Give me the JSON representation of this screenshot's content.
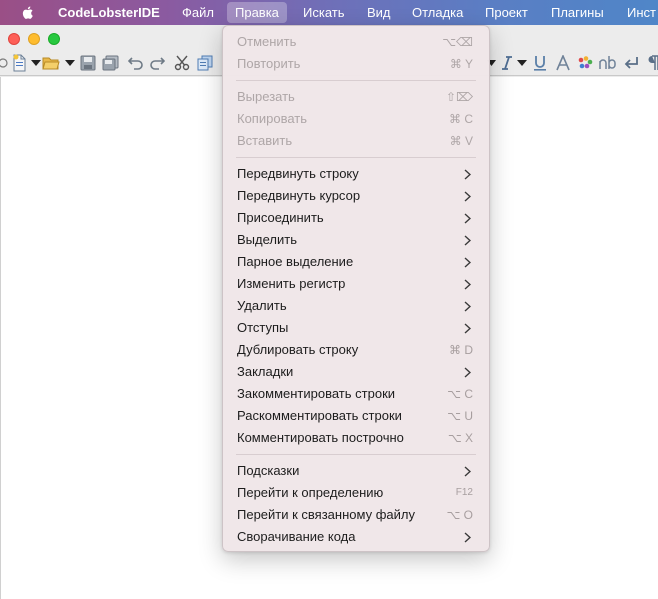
{
  "menubar": {
    "app_name": "CodeLobsterIDE",
    "items": [
      "Файл",
      "Правка",
      "Искать",
      "Вид",
      "Отладка",
      "Проект",
      "Плагины",
      "Инст"
    ],
    "active_item": "Правка"
  },
  "colors": {
    "menu_bg": "#f0e7e9",
    "disabled_text": "#aea6a7",
    "shortcut_text": "#a79e9f",
    "text": "#1d1d1d"
  },
  "icons": {
    "toolbar": [
      "new-file-icon",
      "open-folder-icon",
      "save-icon",
      "save-all-icon",
      "undo-icon",
      "redo-icon",
      "cut-icon",
      "copy-icon",
      "italic-icon",
      "underline-icon",
      "font-icon",
      "color-palette-icon",
      "nbsp-icon",
      "line-break-icon",
      "paragraph-icon"
    ]
  },
  "edit_menu": {
    "items": [
      {
        "label": "Отменить",
        "shortcut": "⌥⌫",
        "disabled": true
      },
      {
        "label": "Повторить",
        "shortcut": "⌘ Y",
        "disabled": true
      },
      {
        "label": "Вырезать",
        "shortcut": "⇧⌦",
        "disabled": true
      },
      {
        "label": "Копировать",
        "shortcut": "⌘ C",
        "disabled": true
      },
      {
        "label": "Вставить",
        "shortcut": "⌘ V",
        "disabled": true
      },
      {
        "label": "Передвинуть строку",
        "submenu": true
      },
      {
        "label": "Передвинуть курсор",
        "submenu": true
      },
      {
        "label": "Присоединить",
        "submenu": true
      },
      {
        "label": "Выделить",
        "submenu": true
      },
      {
        "label": "Парное выделение",
        "submenu": true
      },
      {
        "label": "Изменить регистр",
        "submenu": true
      },
      {
        "label": "Удалить",
        "submenu": true
      },
      {
        "label": "Отступы",
        "submenu": true
      },
      {
        "label": "Дублировать строку",
        "shortcut": "⌘ D"
      },
      {
        "label": "Закладки",
        "submenu": true
      },
      {
        "label": "Закомментировать строки",
        "shortcut": "⌥ C"
      },
      {
        "label": "Раскомментировать строки",
        "shortcut": "⌥ U"
      },
      {
        "label": "Комментировать построчно",
        "shortcut": "⌥ X"
      },
      {
        "label": "Подсказки",
        "submenu": true
      },
      {
        "label": "Перейти к определению",
        "shortcut": "F12"
      },
      {
        "label": "Перейти к связанному файлу",
        "shortcut": "⌥ O"
      },
      {
        "label": "Сворачивание кода",
        "submenu": true
      }
    ]
  }
}
